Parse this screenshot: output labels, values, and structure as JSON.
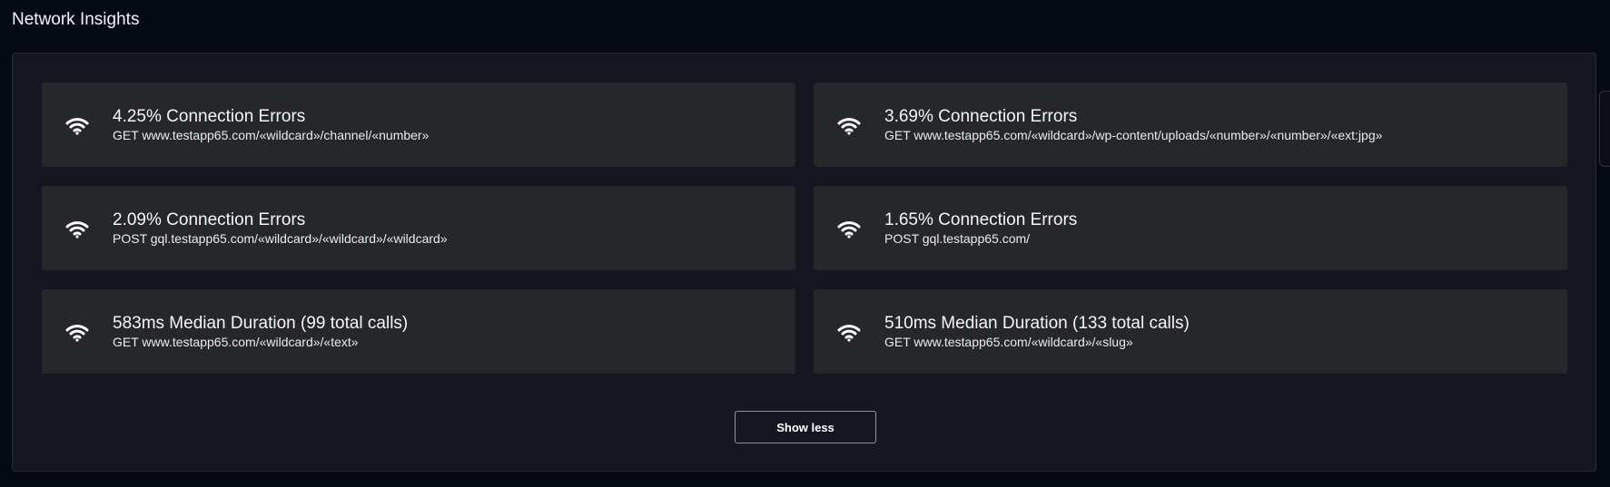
{
  "section": {
    "title": "Network Insights"
  },
  "insights": [
    {
      "headline": "4.25% Connection Errors",
      "endpoint": "GET www.testapp65.com/«wildcard»/channel/«number»",
      "icon": "wifi-icon"
    },
    {
      "headline": "3.69% Connection Errors",
      "endpoint": "GET www.testapp65.com/«wildcard»/wp-content/uploads/«number»/«number»/«ext:jpg»",
      "icon": "wifi-icon"
    },
    {
      "headline": "2.09% Connection Errors",
      "endpoint": "POST gql.testapp65.com/«wildcard»/«wildcard»/«wildcard»",
      "icon": "wifi-icon"
    },
    {
      "headline": "1.65% Connection Errors",
      "endpoint": "POST gql.testapp65.com/",
      "icon": "wifi-icon"
    },
    {
      "headline": "583ms Median Duration (99 total calls)",
      "endpoint": "GET www.testapp65.com/«wildcard»/«text»",
      "icon": "wifi-icon"
    },
    {
      "headline": "510ms Median Duration (133 total calls)",
      "endpoint": "GET www.testapp65.com/«wildcard»/«slug»",
      "icon": "wifi-icon"
    }
  ],
  "actions": {
    "show_less_label": "Show less"
  },
  "colors": {
    "background": "#060a14",
    "panel": "#14171f",
    "card": "#26272b",
    "text": "#ffffff"
  }
}
